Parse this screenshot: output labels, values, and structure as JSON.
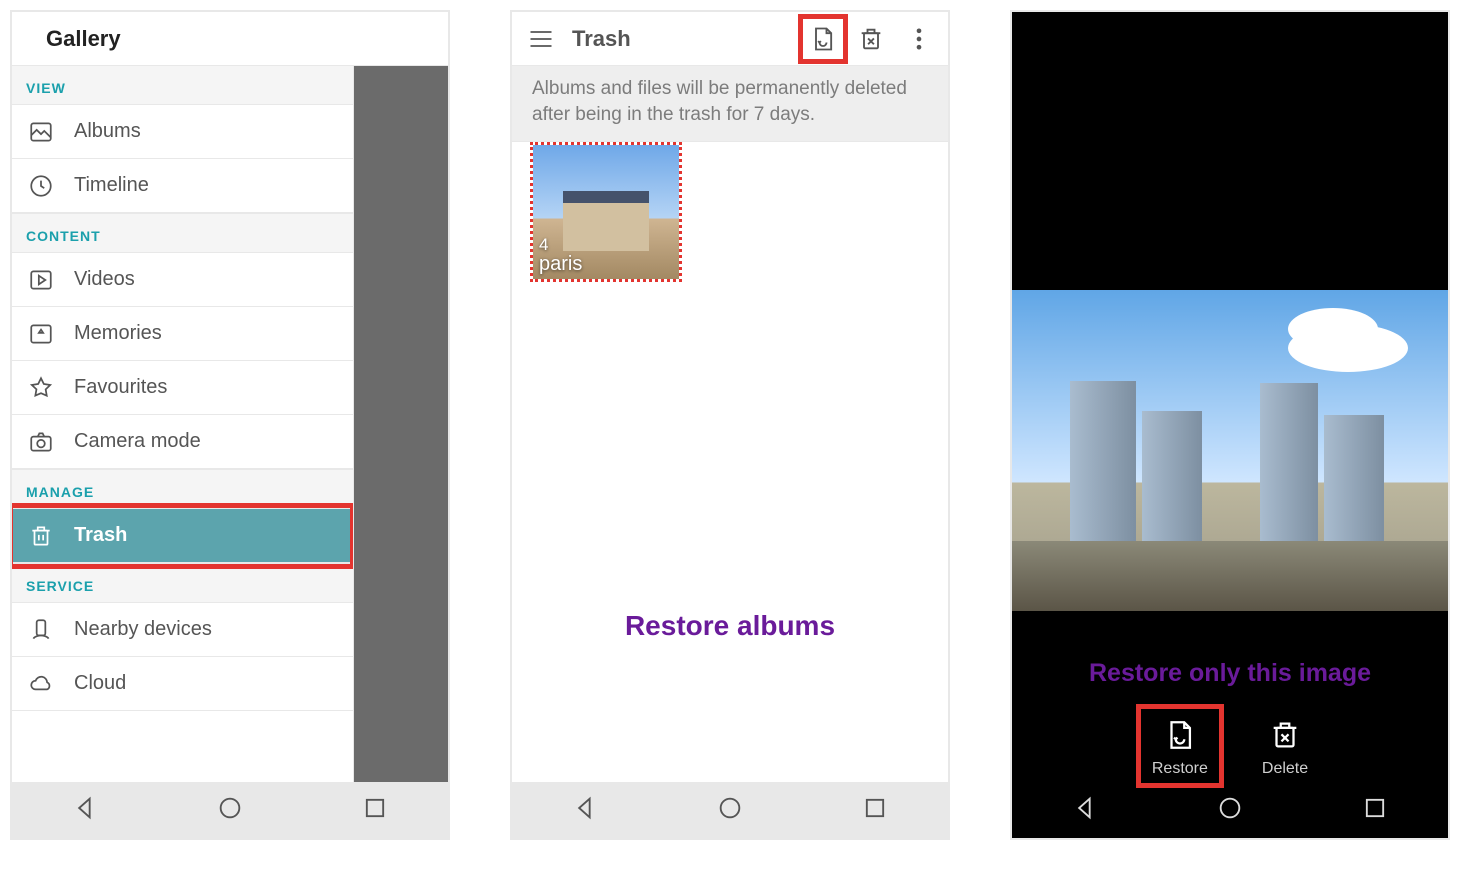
{
  "panel1": {
    "header_title": "Gallery",
    "sections": {
      "view": {
        "label": "VIEW",
        "items": {
          "albums": "Albums",
          "timeline": "Timeline"
        }
      },
      "content": {
        "label": "CONTENT",
        "items": {
          "videos": "Videos",
          "memories": "Memories",
          "favourites": "Favourites",
          "camera_mode": "Camera mode"
        }
      },
      "manage": {
        "label": "MANAGE",
        "items": {
          "trash": "Trash"
        }
      },
      "service": {
        "label": "SERVICE",
        "items": {
          "nearby": "Nearby devices",
          "cloud": "Cloud"
        }
      }
    }
  },
  "panel2": {
    "header_title": "Trash",
    "notice": "Albums and files will be permanently deleted after being in the trash for 7 days.",
    "thumb": {
      "count": "4",
      "label": "paris"
    },
    "caption": "Restore albums"
  },
  "panel3": {
    "caption": "Restore  only this image",
    "actions": {
      "restore": "Restore",
      "delete": "Delete"
    }
  }
}
